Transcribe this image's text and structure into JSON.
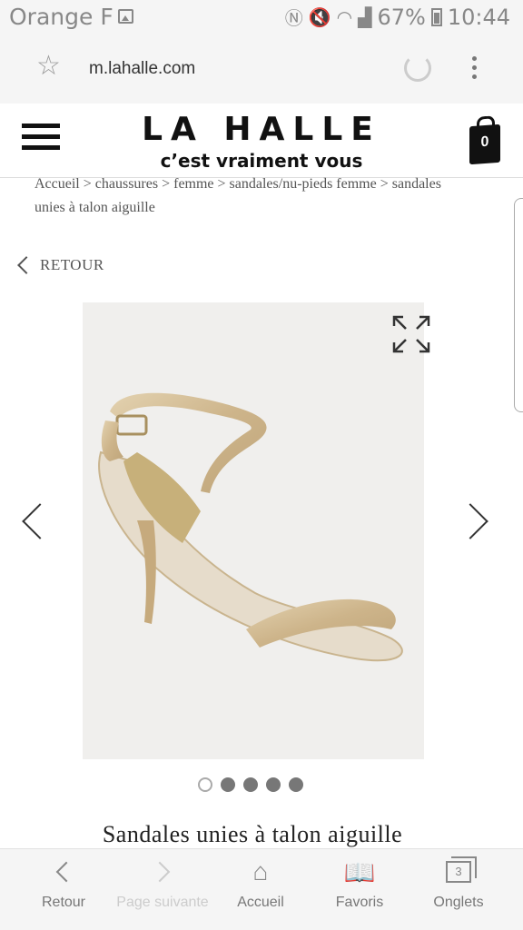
{
  "status_bar": {
    "carrier": "Orange F",
    "battery": "67%",
    "time": "10:44"
  },
  "browser": {
    "url": "m.lahalle.com"
  },
  "site": {
    "logo": "LA HALLE",
    "tagline": "c’est vraiment vous",
    "cart_count": "0"
  },
  "breadcrumb": "Accueil > chaussures > femme > sandales/nu-pieds femme > sandales unies à talon aiguille",
  "back_label": "RETOUR",
  "product": {
    "title": "Sandales unies à talon aiguille",
    "image_count": 5,
    "active_image": 1
  },
  "bottom_nav": [
    {
      "label": "Retour",
      "icon": "back-icon"
    },
    {
      "label": "Page suivante",
      "icon": "forward-icon"
    },
    {
      "label": "Accueil",
      "icon": "home-icon"
    },
    {
      "label": "Favoris",
      "icon": "bookmarks-icon"
    },
    {
      "label": "Onglets",
      "icon": "tabs-icon",
      "count": "3"
    }
  ]
}
